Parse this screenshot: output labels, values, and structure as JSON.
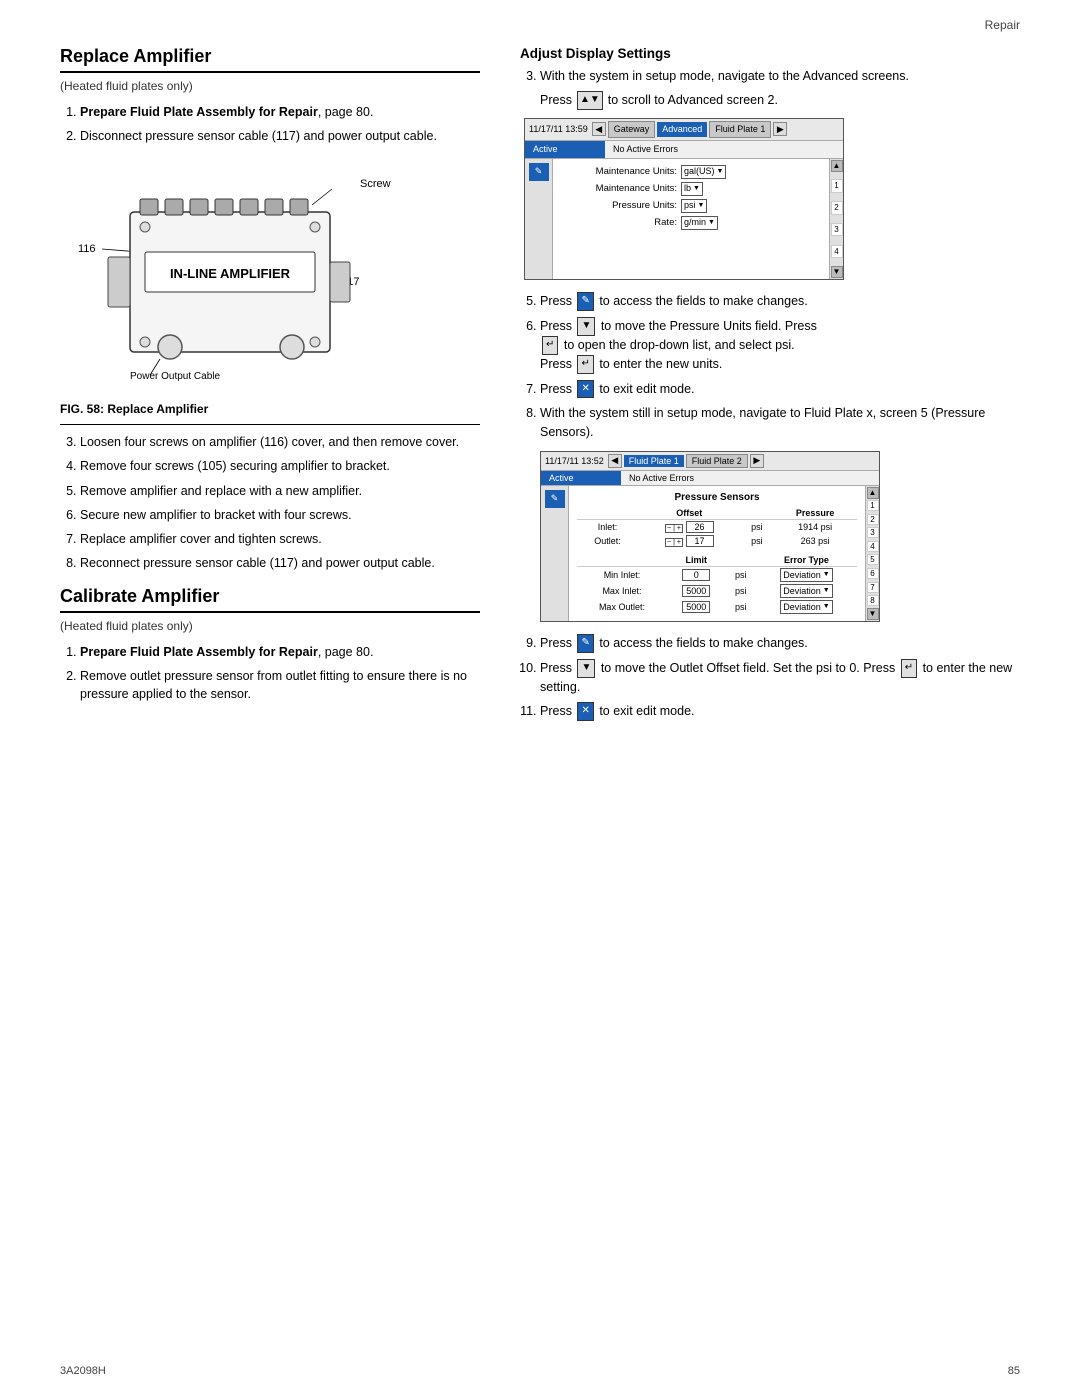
{
  "header": {
    "label": "Repair"
  },
  "footer": {
    "left": "3A2098H",
    "right": "85"
  },
  "left_col": {
    "section1_title": "Replace Amplifier",
    "section1_subtitle": "(Heated fluid plates only)",
    "steps_before_fig": [
      {
        "num": 1,
        "bold": "Prepare Fluid Plate Assembly for Repair",
        "rest": ", page 80."
      },
      {
        "num": 2,
        "text": "Disconnect pressure sensor cable (117) and power output cable."
      }
    ],
    "diagram_labels": {
      "screw": "Screw",
      "power_output": "Power Output Cable",
      "num116": "116",
      "num117": "117",
      "amplifier_text": "IN-LINE AMPLIFIER"
    },
    "fig_caption": "FIG. 58: Replace Amplifier",
    "steps_after_fig": [
      {
        "num": 3,
        "text": "Loosen four screws on amplifier (116) cover, and then remove cover."
      },
      {
        "num": 4,
        "text": "Remove four screws (105) securing amplifier to bracket."
      },
      {
        "num": 5,
        "text": "Remove amplifier and replace with a new amplifier."
      },
      {
        "num": 6,
        "text": "Secure new amplifier to bracket with four screws."
      },
      {
        "num": 7,
        "text": "Replace amplifier cover and tighten screws."
      },
      {
        "num": 8,
        "text": "Reconnect pressure sensor cable (117) and power output cable."
      }
    ],
    "section2_title": "Calibrate Amplifier",
    "section2_subtitle": "(Heated fluid plates only)",
    "calibrate_steps": [
      {
        "num": 1,
        "bold": "Prepare Fluid Plate Assembly for Repair",
        "rest": ", page 80."
      },
      {
        "num": 2,
        "text": "Remove outlet pressure sensor from outlet fitting to ensure there is no pressure applied to the sensor."
      }
    ]
  },
  "right_col": {
    "adjust_title": "Adjust Display Settings",
    "step3_text": "With the system in setup mode, navigate to the Advanced screens.",
    "step4_text": "Press",
    "step4_suffix": "to scroll to Advanced screen 2.",
    "screen1": {
      "timestamp": "11/17/11 13:59",
      "tabs": [
        "Gateway",
        "Advanced",
        "Fluid Plate 1"
      ],
      "status_active": "Active",
      "status_error": "No Active Errors",
      "edit_icon": "✎",
      "rows": [
        {
          "label": "Maintenance Units:",
          "value": "gal(US)",
          "dropdown": true
        },
        {
          "label": "Maintenance Units:",
          "value": "lb",
          "dropdown": true
        },
        {
          "label": "Pressure Units:",
          "value": "psi",
          "dropdown": true
        },
        {
          "label": "Rate:",
          "value": "g/min",
          "dropdown": true
        }
      ],
      "scroll_nums": [
        "1",
        "2",
        "3",
        "4"
      ]
    },
    "step5_text": "Press",
    "step5_suffix": "to access the fields to make changes.",
    "step6_text": "Press",
    "step6_mid": "to move the Pressure Units field. Press",
    "step6_mid2": "to open the drop-down list, and select psi.",
    "step6_end": "Press",
    "step6_end2": "to enter the new units.",
    "step7_text": "Press",
    "step7_suffix": "to exit edit mode.",
    "step8_text": "With the system still in setup mode, navigate to Fluid Plate x, screen 5 (Pressure Sensors).",
    "screen2": {
      "timestamp": "11/17/11 13:52",
      "tabs": [
        "Fluid Plate 1",
        "Fluid Plate 2"
      ],
      "status_active": "Active",
      "status_error": "No Active Errors",
      "edit_icon": "✎",
      "section_title": "Pressure Sensors",
      "col_headers": [
        "Offset",
        "Pressure"
      ],
      "rows_data": [
        {
          "label": "Inlet:",
          "offset": "26",
          "unit1": "psi",
          "pressure": "1914 psi"
        },
        {
          "label": "Outlet:",
          "offset": "17",
          "unit1": "psi",
          "pressure": "263 psi"
        }
      ],
      "limit_section": {
        "title": "Limit",
        "rows": [
          {
            "label": "Min Inlet:",
            "value": "0",
            "unit": "psi"
          },
          {
            "label": "Max Inlet:",
            "value": "5000",
            "unit": "psi"
          },
          {
            "label": "Max Outlet:",
            "value": "5000",
            "unit": "psi"
          }
        ]
      },
      "error_section": {
        "title": "Error Type",
        "rows": [
          "Deviation",
          "Deviation",
          "Deviation"
        ]
      },
      "scroll_nums": [
        "1",
        "2",
        "3",
        "4",
        "5",
        "6",
        "7",
        "8"
      ]
    },
    "step9_text": "Press",
    "step9_suffix": "to access the fields to make changes.",
    "step10_text": "Press",
    "step10_mid": "to move the Outlet Offset field. Set the psi to 0. Press",
    "step10_end": "to enter the new setting.",
    "step11_text": "Press",
    "step11_suffix": "to exit edit mode."
  }
}
